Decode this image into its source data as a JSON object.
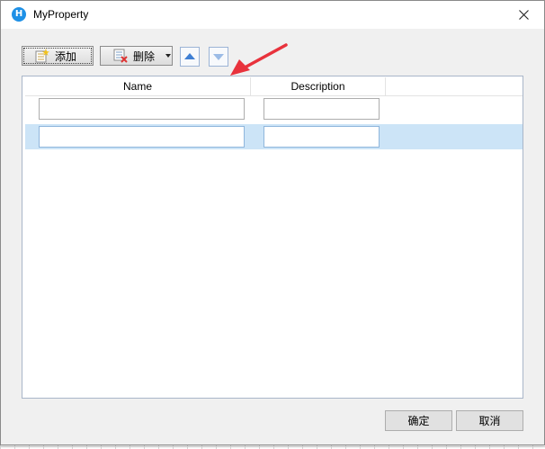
{
  "window": {
    "title": "MyProperty"
  },
  "toolbar": {
    "add_label": "添加",
    "delete_label": "删除",
    "icons": {
      "add": "add-row-icon",
      "delete": "delete-row-icon",
      "up": "move-up-icon",
      "down": "move-down-icon"
    }
  },
  "table": {
    "columns": [
      "Name",
      "Description"
    ],
    "rows": [
      {
        "name": "",
        "description": ""
      },
      {
        "name": "",
        "description": "",
        "selected": true
      }
    ]
  },
  "footer": {
    "ok_label": "确定",
    "cancel_label": "取消"
  },
  "colors": {
    "selection": "#cce4f7",
    "annotation_arrow": "#e8323c",
    "app_icon": "#1e90e6"
  }
}
